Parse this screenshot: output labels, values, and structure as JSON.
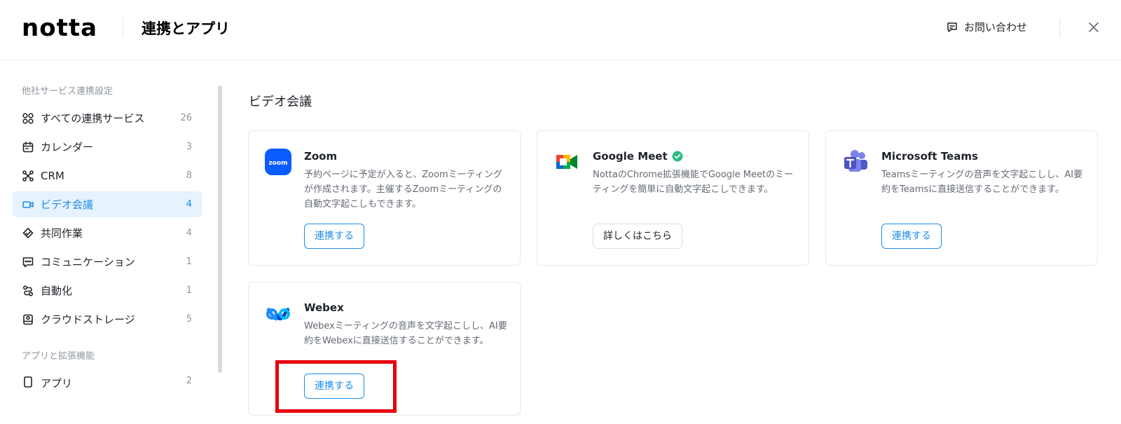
{
  "header": {
    "logo": "notta",
    "title": "連携とアプリ",
    "contact_label": "お問い合わせ"
  },
  "sidebar": {
    "section1_label": "他社サービス連携設定",
    "items": [
      {
        "label": "すべての連携サービス",
        "count": "26",
        "icon": "grid-icon"
      },
      {
        "label": "カレンダー",
        "count": "3",
        "icon": "calendar-icon"
      },
      {
        "label": "CRM",
        "count": "8",
        "icon": "crm-icon"
      },
      {
        "label": "ビデオ会議",
        "count": "4",
        "icon": "video-icon",
        "active": true
      },
      {
        "label": "共同作業",
        "count": "4",
        "icon": "collaboration-icon"
      },
      {
        "label": "コミュニケーション",
        "count": "1",
        "icon": "chat-icon"
      },
      {
        "label": "自動化",
        "count": "1",
        "icon": "automation-icon"
      },
      {
        "label": "クラウドストレージ",
        "count": "5",
        "icon": "storage-icon"
      }
    ],
    "section2_label": "アプリと拡張機能",
    "apps_item": {
      "label": "アプリ",
      "count": "2",
      "icon": "app-icon"
    }
  },
  "main": {
    "title": "ビデオ会議",
    "cards": [
      {
        "name": "Zoom",
        "desc": "予約ページに予定が入ると、Zoomミーティングが作成されます。主催するZoomミーティングの自動文字起こしもできます。",
        "button": "連携する",
        "logo": "zoom-logo-icon"
      },
      {
        "name": "Google Meet",
        "desc": "NottaのChrome拡張機能でGoogle Meetのミーティングを簡単に自動文字起こしできます。",
        "button": "詳しくはこちら",
        "logo": "google-meet-logo-icon",
        "verified": true
      },
      {
        "name": "Microsoft Teams",
        "desc": "Teamsミーティングの音声を文字起こしし、AI要約をTeamsに直接送信することができます。",
        "button": "連携する",
        "logo": "teams-logo-icon"
      },
      {
        "name": "Webex",
        "desc": "Webexミーティングの音声を文字起こしし、AI要約をWebexに直接送信することができます。",
        "button": "連携する",
        "logo": "webex-logo-icon"
      }
    ],
    "zoom_logo_text": "zoom"
  },
  "colors": {
    "accent": "#1d8de8",
    "active_bg": "#e6f2fd",
    "highlight": "#e8000b"
  }
}
